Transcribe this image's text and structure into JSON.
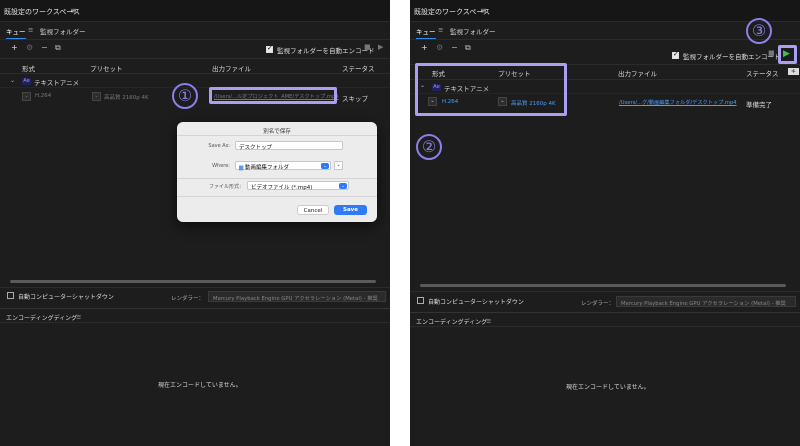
{
  "workspace_title": "既設定のワークスペース",
  "tabs": {
    "queue": "キュー",
    "watch": "監視フォルダー"
  },
  "auto_encode_label": "監視フォルダーを自動エンコード",
  "columns": {
    "format": "形式",
    "preset": "プリセット",
    "output": "出力ファイル",
    "status": "ステータス"
  },
  "item_name": "テキストアニメ",
  "ae_badge": "Ae",
  "left": {
    "format": "H.264",
    "preset": "高品質 2160p 4K",
    "output": "/Users/...ル定プロジェクト_AME/デスクトップ.mp4",
    "status": "スキップ"
  },
  "right": {
    "format": "H.264",
    "preset": "高品質 2160p 4K",
    "output": "/Users/...グ/動画編集フォルダ/デスクトップ.mp4",
    "status": "準備完了"
  },
  "shutdown_label": "自動コンピューターシャットダウン",
  "renderer_label": "レンダラー：",
  "renderer_value": "Mercury Playback Engine GPU アクセラレーション (Metal) - 推奨",
  "encoding_title": "エンコーディングディング",
  "encoding_msg": "現在エンコードしていません。",
  "dialog": {
    "title": "別名で保存",
    "save_as_label": "Save As:",
    "save_as_value": "デスクトップ",
    "where_label": "Where:",
    "where_value": "動画編集フォルダ",
    "format_label": "ファイル形式：",
    "format_value": "ビデオファイル (*.mp4)",
    "cancel": "Cancel",
    "save": "Save"
  },
  "annotations": {
    "one": "①",
    "two": "②",
    "three": "③"
  },
  "accent_color": "#8b7fe8",
  "link_color": "#4c9dff",
  "play_color": "#3fc24a"
}
